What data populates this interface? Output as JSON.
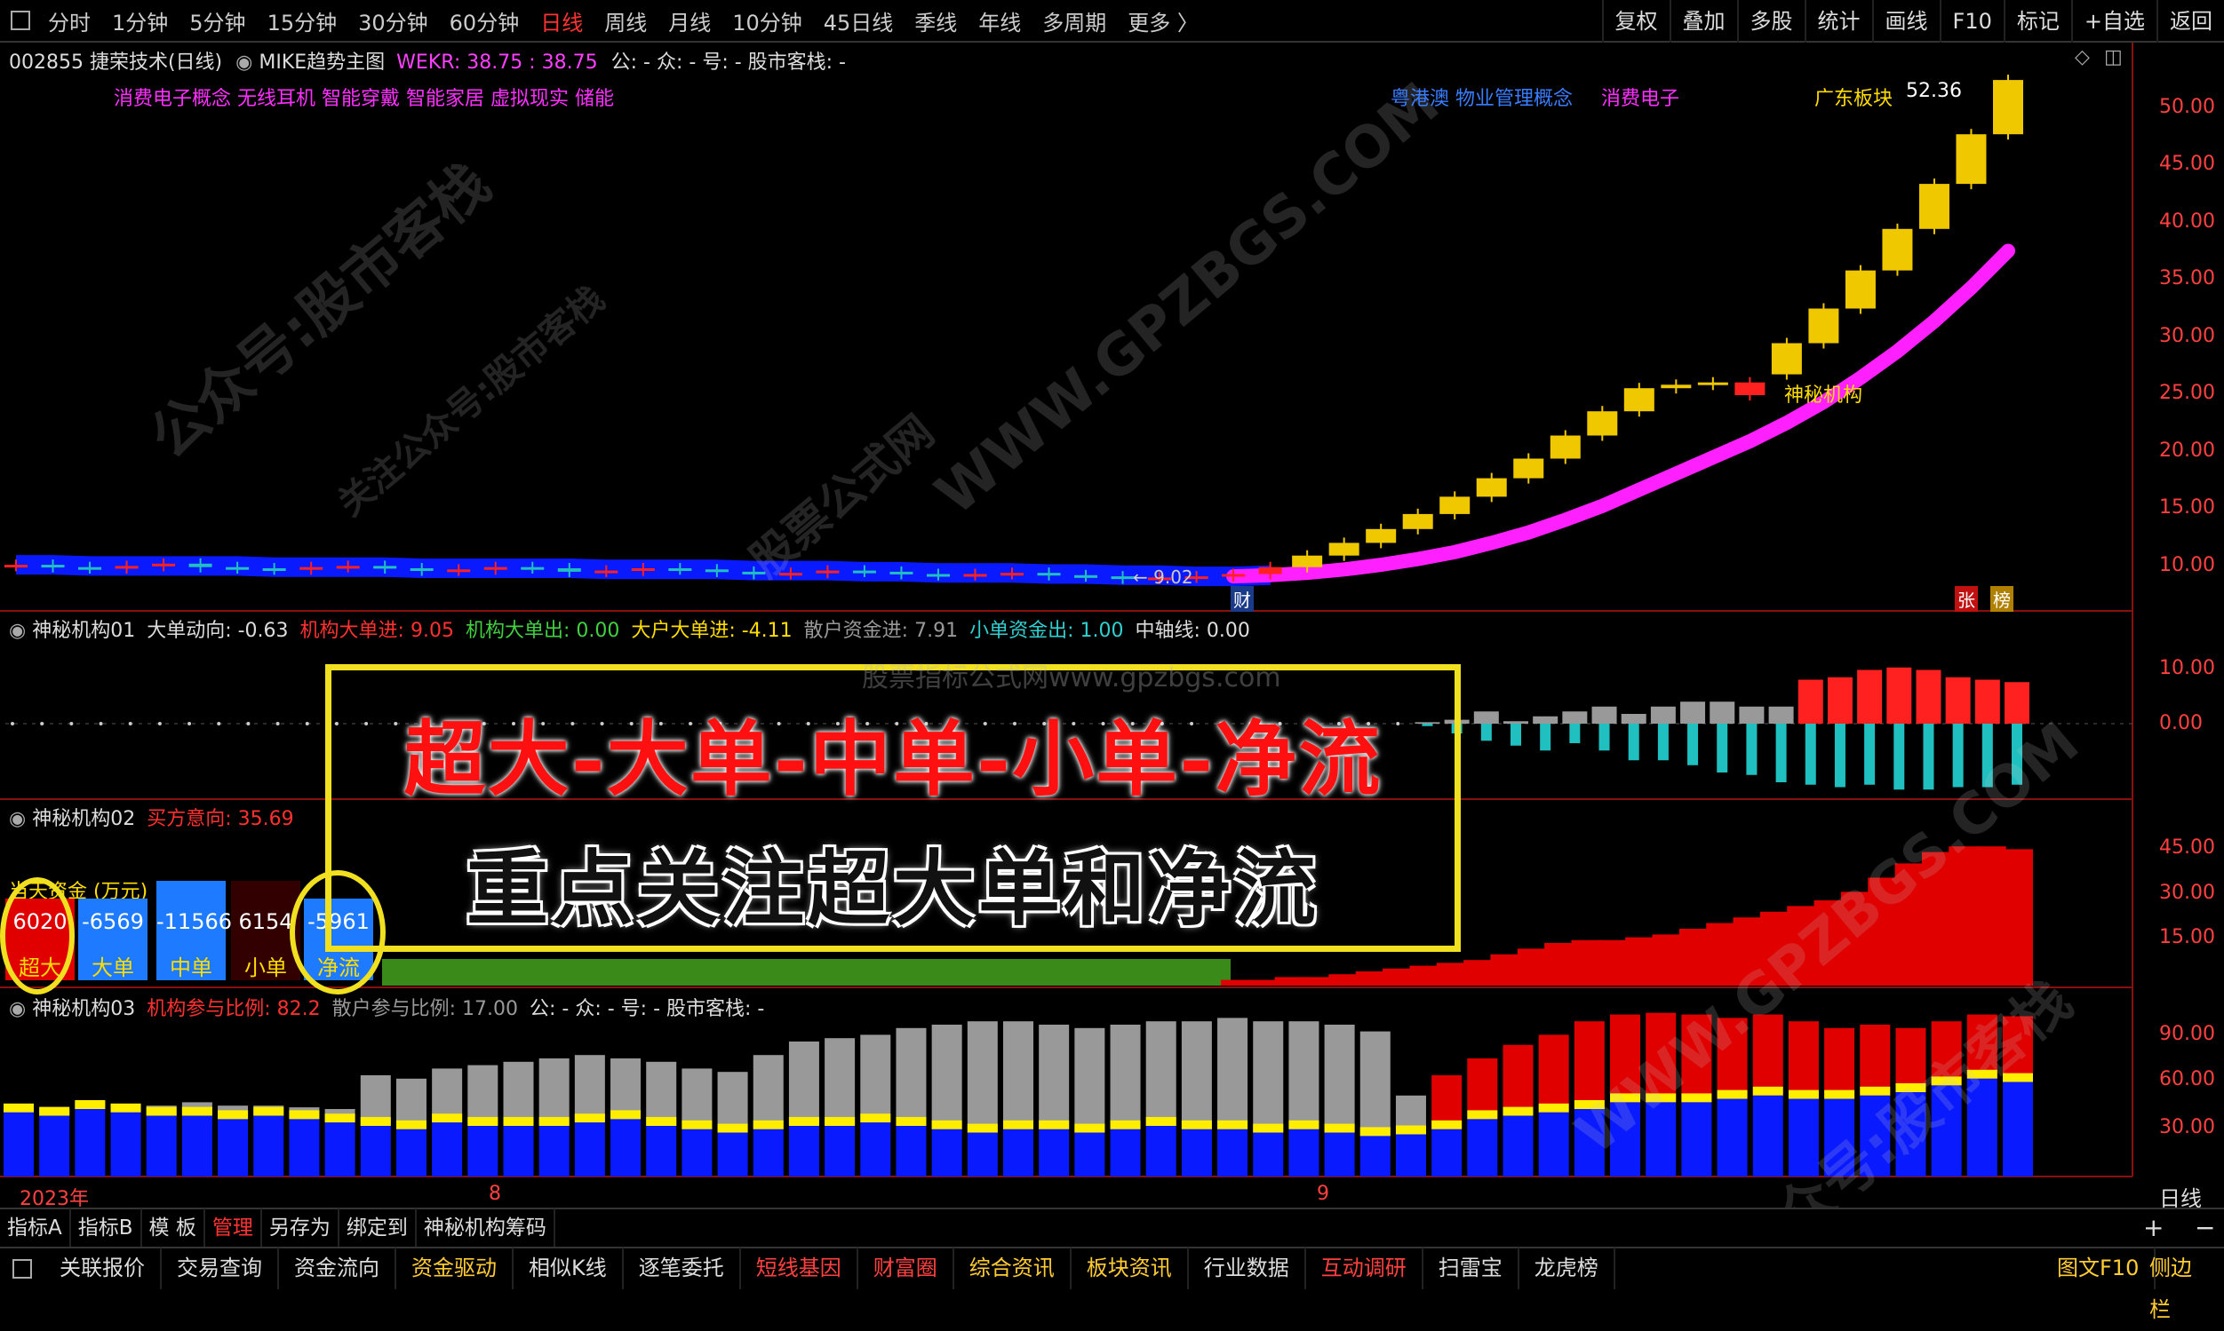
{
  "toolbar": {
    "periods": [
      "分时",
      "1分钟",
      "5分钟",
      "15分钟",
      "30分钟",
      "60分钟",
      "日线",
      "周线",
      "月线",
      "10分钟",
      "45日线",
      "季线",
      "年线",
      "多周期",
      "更多 〉"
    ],
    "active_period": "日线",
    "tools": [
      "复权",
      "叠加",
      "多股",
      "统计",
      "画线",
      "F10",
      "标记",
      "+自选",
      "返回"
    ]
  },
  "main_chart": {
    "code_name": "002855 捷荣技术(日线)",
    "indicator": "MIKE趋势主图",
    "wekr": "WEKR: 38.75 : 38.75",
    "extra": "公: -  众: -  号: -  股市客栈: -",
    "concepts_left": "消费电子概念 无线耳机 智能穿戴 智能家居 虚拟现实 储能",
    "concepts_right_1": "粤港澳 物业管理概念",
    "concepts_right_2": "消费电子",
    "board_label": "广东板块",
    "high_label": "52.36",
    "low_label": "← 9.02",
    "mystery_label": "神秘机构",
    "cai_label": "财",
    "zhang_label": "张",
    "bang_label": "榜",
    "yaxis": [
      "50.00",
      "45.00",
      "40.00",
      "35.00",
      "30.00",
      "25.00",
      "20.00",
      "15.00",
      "10.00"
    ]
  },
  "panel1": {
    "title": "神秘机构01",
    "dir": "大单动向: -0.63",
    "in": "机构大单进: 9.05",
    "out": "机构大单出: 0.00",
    "big_in": "大户大单进: -4.11",
    "retail_in": "散户资金进: 7.91",
    "small_out": "小单资金出: 1.00",
    "axis": "中轴线: 0.00",
    "yaxis": [
      "10.00",
      "0.00"
    ]
  },
  "panel2": {
    "title": "神秘机构02",
    "buy": "买方意向: 35.69",
    "yaxis": [
      "45.00",
      "30.00",
      "15.00"
    ],
    "flow_title": "当天资金 (万元)",
    "boxes": [
      {
        "value": "6020",
        "label": "超大"
      },
      {
        "value": "-6569",
        "label": "大单"
      },
      {
        "value": "-11566",
        "label": "中单"
      },
      {
        "value": "6154",
        "label": "小单"
      },
      {
        "value": "-5961",
        "label": "净流"
      }
    ]
  },
  "panel3": {
    "title": "神秘机构03",
    "inst": "机构参与比例: 82.2",
    "retail": "散户参与比例: 17.00",
    "extra": "公: -  众: -  号: -  股市客栈: -",
    "yaxis": [
      "90.00",
      "60.00",
      "30.00"
    ]
  },
  "xaxis": {
    "year": "2023年",
    "m8": "8",
    "m9": "9",
    "period": "日线"
  },
  "caption": {
    "line1": "超大-大单-中单-小单-净流",
    "line2": "重点关注超大单和净流"
  },
  "tabs": [
    "指标A",
    "指标B",
    "模 板",
    "管理",
    "另存为",
    "绑定到",
    "神秘机构筹码"
  ],
  "active_tab": "管理",
  "bottom": [
    "关联报价",
    "交易查询",
    "资金流向",
    "资金驱动",
    "相似K线",
    "逐笔委托",
    "短线基因",
    "财富圈",
    "综合资讯",
    "板块资讯",
    "行业数据",
    "互动调研",
    "扫雷宝",
    "龙虎榜",
    "图文F10",
    "侧边栏"
  ],
  "watermarks": [
    "公众号:股市客栈",
    "关注公众号:股市客栈",
    "WWW.GPZBGS.COM",
    "股票公式网",
    "股票指标公式网www.gpzbgs.com"
  ],
  "colors": {
    "up": "#ff2020",
    "down": "#20c0c0",
    "gold": "#f0c800",
    "magenta": "#ff20ff",
    "blue": "#0a1aff",
    "accent": "#ff3333"
  },
  "chart_data": {
    "type": "candlestick",
    "candles_open": [
      10.2,
      10.3,
      10.1,
      10.0,
      10.2,
      10.4,
      10.1,
      10.0,
      9.9,
      10.1,
      10.2,
      10.0,
      9.8,
      9.9,
      10.1,
      10.0,
      9.7,
      9.8,
      10.0,
      9.9,
      9.7,
      9.5,
      9.6,
      9.8,
      9.7,
      9.5,
      9.4,
      9.5,
      9.6,
      9.4,
      9.3,
      9.1,
      9.2,
      9.3,
      9.5,
      10.1,
      11.1,
      12.2,
      13.4,
      14.7,
      16.2,
      17.8,
      19.5,
      21.5,
      23.6,
      25.6,
      25.9,
      26.1,
      26.8,
      29.5,
      32.5,
      35.8,
      39.4,
      43.3,
      47.6
    ],
    "candles_close": [
      10.3,
      10.1,
      10.0,
      10.2,
      10.4,
      10.1,
      10.0,
      9.9,
      10.1,
      10.2,
      10.0,
      9.8,
      9.9,
      10.1,
      10.0,
      9.7,
      9.8,
      10.0,
      9.9,
      9.7,
      9.5,
      9.6,
      9.8,
      9.7,
      9.5,
      9.4,
      9.5,
      9.6,
      9.4,
      9.3,
      9.1,
      9.2,
      9.3,
      9.5,
      10.1,
      11.1,
      12.2,
      13.4,
      14.7,
      16.2,
      17.8,
      19.5,
      21.5,
      23.6,
      25.6,
      25.9,
      26.1,
      25.0,
      29.5,
      32.5,
      35.8,
      39.4,
      43.3,
      47.6,
      52.3
    ],
    "ma": [
      10.3,
      10.3,
      10.2,
      10.2,
      10.2,
      10.2,
      10.2,
      10.1,
      10.1,
      10.1,
      10.1,
      10.0,
      10.0,
      10.0,
      10.0,
      10.0,
      9.9,
      9.9,
      9.9,
      9.9,
      9.8,
      9.8,
      9.8,
      9.7,
      9.7,
      9.6,
      9.6,
      9.6,
      9.5,
      9.5,
      9.4,
      9.4,
      9.3,
      9.3,
      9.4,
      9.6,
      9.9,
      10.3,
      10.8,
      11.4,
      12.2,
      13.1,
      14.2,
      15.4,
      16.8,
      18.2,
      19.6,
      21.0,
      22.6,
      24.4,
      26.5,
      28.8,
      31.4,
      34.3,
      37.5
    ],
    "panel1_up": [
      0,
      0,
      0,
      0,
      0,
      0,
      0,
      0,
      0,
      0,
      0,
      0,
      0,
      0,
      0,
      0,
      0,
      0,
      0,
      0,
      0,
      0,
      0,
      0,
      0,
      0,
      0,
      0,
      0,
      0,
      0,
      0,
      0,
      0,
      0,
      0,
      0,
      0,
      0,
      0,
      0,
      0,
      0,
      0,
      0,
      0,
      0,
      0,
      0.3,
      0.8,
      2.5,
      0.5,
      1.5,
      2.5,
      3.5,
      2.0,
      3.5,
      4.5,
      4.5,
      3.5,
      3.5,
      9.0,
      9.5,
      11.0,
      11.5,
      11.0,
      9.5,
      9.0,
      8.5
    ],
    "panel1_down": [
      0,
      0,
      0,
      0,
      0,
      0,
      0,
      0,
      0,
      0,
      0,
      0,
      0,
      0,
      0,
      0,
      0,
      0,
      0,
      0,
      0,
      0,
      0,
      0,
      0,
      0,
      0,
      0,
      0,
      0,
      0,
      0,
      0,
      0,
      0,
      0,
      0,
      0,
      0,
      0,
      0,
      0,
      0,
      0,
      0,
      0,
      0,
      0,
      0.5,
      2.0,
      3.5,
      4.5,
      5.5,
      4.0,
      5.5,
      7.5,
      7.5,
      8.5,
      10.0,
      10.5,
      12.0,
      12.5,
      13.0,
      12.5,
      13.5,
      13.5,
      13.0,
      13.0,
      12.5
    ],
    "panel2": [
      2,
      2,
      3,
      3,
      4,
      5,
      6,
      7,
      8,
      9,
      11,
      13,
      15,
      16,
      16,
      17,
      18,
      20,
      22,
      24,
      26,
      28,
      30,
      33,
      38,
      43,
      47,
      49,
      49,
      48
    ],
    "panel3_total": [
      42,
      40,
      44,
      43,
      42,
      44,
      42,
      42,
      41,
      40,
      60,
      58,
      64,
      66,
      68,
      70,
      72,
      70,
      68,
      64,
      62,
      72,
      80,
      82,
      84,
      88,
      90,
      92,
      92,
      90,
      88,
      90,
      92,
      92,
      94,
      92,
      92,
      90,
      86,
      48,
      60,
      70,
      78,
      84,
      92,
      96,
      97,
      96,
      94,
      96,
      92,
      88,
      90,
      88,
      92,
      96,
      95
    ],
    "panel3_blue": [
      38,
      36,
      40,
      38,
      36,
      36,
      34,
      36,
      34,
      32,
      30,
      28,
      32,
      30,
      30,
      30,
      32,
      34,
      30,
      28,
      26,
      28,
      30,
      30,
      32,
      30,
      28,
      26,
      28,
      28,
      26,
      28,
      30,
      28,
      28,
      26,
      28,
      26,
      24,
      25,
      28,
      34,
      36,
      38,
      40,
      44,
      44,
      44,
      46,
      48,
      46,
      46,
      48,
      50,
      54,
      58,
      56
    ]
  }
}
